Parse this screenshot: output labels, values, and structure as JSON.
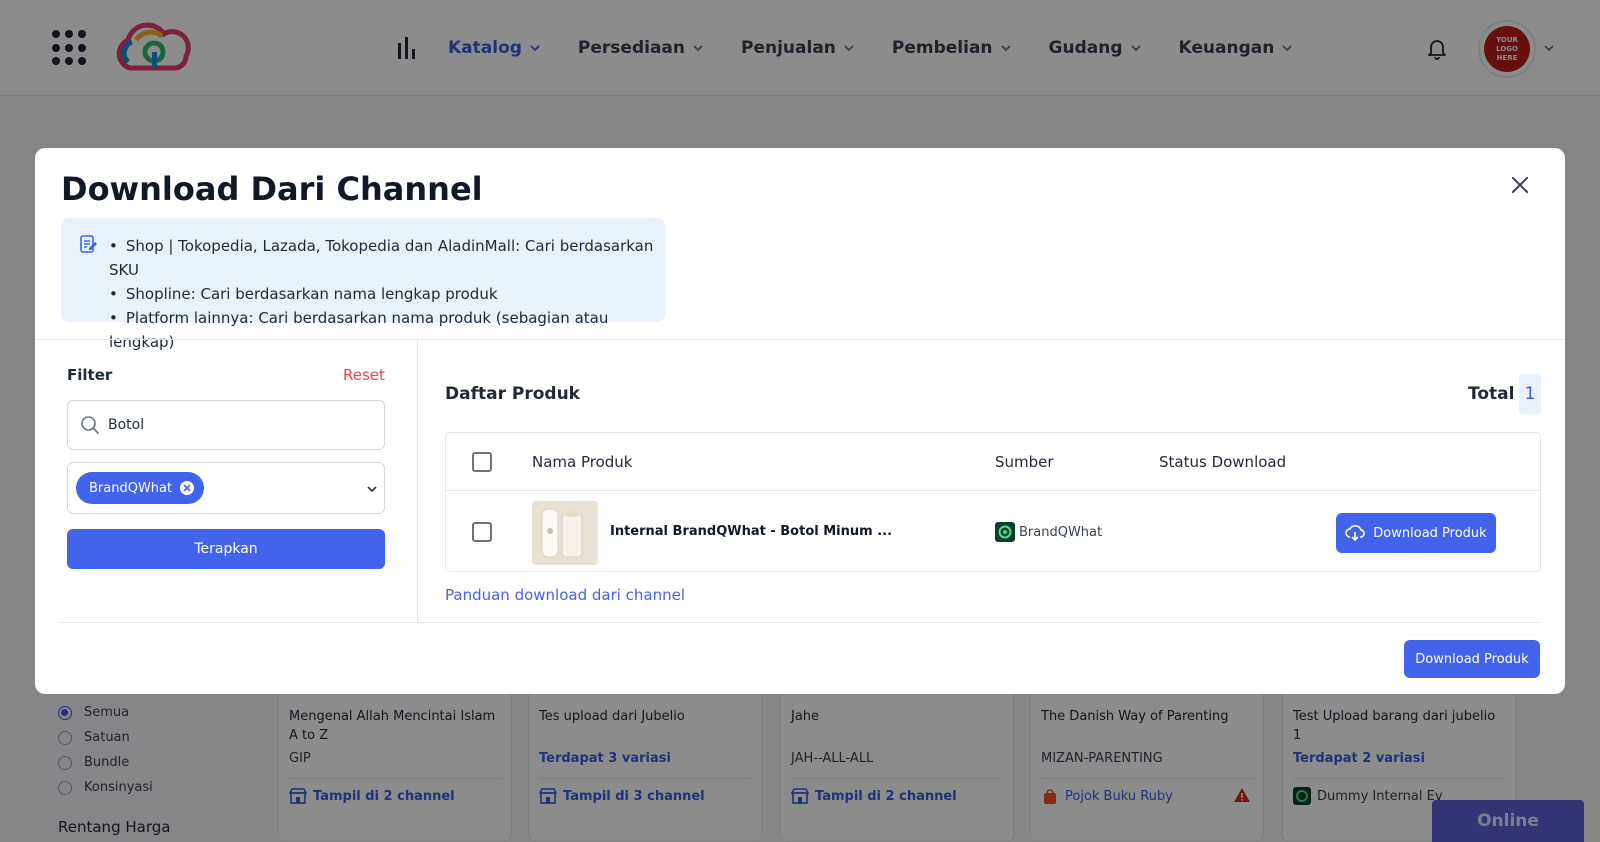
{
  "nav": {
    "items": [
      {
        "label": "Katalog",
        "active": true
      },
      {
        "label": "Persediaan",
        "active": false
      },
      {
        "label": "Penjualan",
        "active": false
      },
      {
        "label": "Pembelian",
        "active": false
      },
      {
        "label": "Gudang",
        "active": false
      },
      {
        "label": "Keuangan",
        "active": false
      }
    ],
    "avatar_text": [
      "YOUR",
      "LOGO",
      "HERE"
    ],
    "accent": "#3b5bdb"
  },
  "background": {
    "type_filters": [
      {
        "label": "Semua",
        "selected": true
      },
      {
        "label": "Satuan",
        "selected": false
      },
      {
        "label": "Bundle",
        "selected": false
      },
      {
        "label": "Konsinyasi",
        "selected": false
      }
    ],
    "price_section": "Rentang Harga",
    "cards": [
      {
        "name": "Mengenal Allah Mencintai Islam A to Z",
        "sub": "GIP",
        "channel": "Tampil di 2 channel"
      },
      {
        "name": "Tes upload dari Jubelio",
        "sub": "Terdapat 3 variasi",
        "channel": "Tampil di 3 channel"
      },
      {
        "name": "Jahe",
        "sub": "JAH--ALL-ALL",
        "channel": "Tampil di 2 channel"
      },
      {
        "name": "The Danish Way of Parenting",
        "sub": "MIZAN-PARENTING",
        "channel": "Pojok Buku Ruby"
      },
      {
        "name": "Test Upload barang dari jubelio 1",
        "sub": "Terdapat 2 variasi",
        "channel": "Dummy Internal Ev"
      }
    ],
    "online_label": "Online"
  },
  "modal": {
    "title": "Download Dari Channel",
    "info": [
      "Shop | Tokopedia, Lazada, Tokopedia dan AladinMall: Cari berdasarkan SKU",
      "Shopline: Cari berdasarkan nama lengkap produk",
      "Platform lainnya: Cari berdasarkan nama produk (sebagian atau lengkap)"
    ],
    "filter": {
      "title": "Filter",
      "reset": "Reset",
      "search_value": "Botol",
      "chip": "BrandQWhat",
      "apply": "Terapkan"
    },
    "list": {
      "title": "Daftar Produk",
      "total_label": "Total",
      "total_count": "1",
      "columns": [
        "Nama Produk",
        "Sumber",
        "Status Download"
      ],
      "rows": [
        {
          "name": "Internal BrandQWhat - Botol Minum ...",
          "source": "BrandQWhat",
          "status": "",
          "action": "Download Produk"
        }
      ],
      "guide_link": "Panduan download dari channel",
      "download_button": "Download Produk"
    }
  }
}
